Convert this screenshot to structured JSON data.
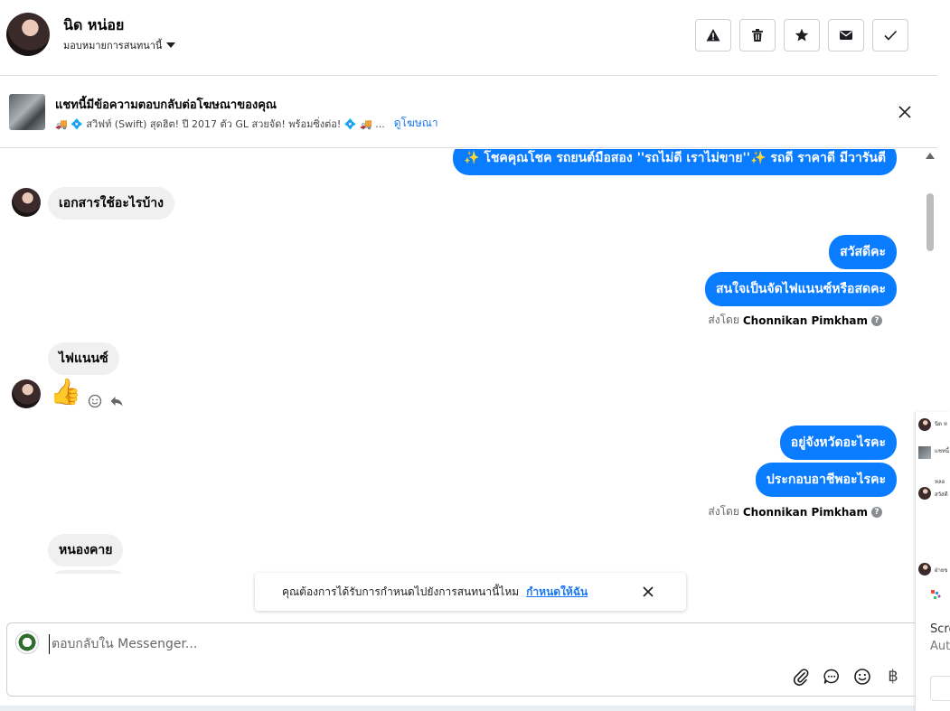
{
  "header": {
    "contact_name": "นิด หน่อย",
    "assign_label": "มอบหมายการสนทนานี้",
    "actions": [
      {
        "name": "spam-button",
        "icon": "warning-icon"
      },
      {
        "name": "delete-button",
        "icon": "trash-icon"
      },
      {
        "name": "star-button",
        "icon": "star-icon"
      },
      {
        "name": "mark-unread-button",
        "icon": "envelope-icon"
      },
      {
        "name": "done-button",
        "icon": "check-icon"
      }
    ]
  },
  "ad_banner": {
    "title": "แชทนี้มีข้อความตอบกลับต่อโฆษณาของคุณ",
    "description": "🚚 💠 สวิฟท์ (Swift) สุดฮิต! ปี 2017 ตัว GL สวยจัด! พร้อมซิ่งต่อ! 💠 🚚 ...",
    "link_label": "ดูโฆษณา"
  },
  "messages": {
    "top_partial": "✨ โชคคุณโชค รถยนต์มือสอง ''รถไม่ดี เราไม่ขาย''✨ รถดี ราคาดี มีวารันตี",
    "in_1": "เอกสารใช้อะไรบ้าง",
    "out_1": "สวัสดีคะ",
    "out_2": "สนใจเป็นจัดไฟแนนซ์หรือสดคะ",
    "sent_by_prefix_1": "ส่งโดย",
    "sent_by_name_1": "Chonnikan Pimkham",
    "in_2": "ไฟแนนซ์",
    "in_3_emoji": "👍",
    "out_3": "อยู่จังหวัดอะไรคะ",
    "out_4": "ประกอบอาชีพอะไรคะ",
    "sent_by_prefix_2": "ส่งโดย",
    "sent_by_name_2": "Chonnikan Pimkham",
    "in_4": "หนองคาย"
  },
  "toast": {
    "text": "คุณต้องการได้รับการกำหนดไปยังการสนทนานี้ไหม",
    "link_label": "กำหนดให้ฉัน"
  },
  "composer": {
    "placeholder": "ตอบกลับใน Messenger...",
    "tools": [
      "attachment-icon",
      "saved-reply-icon",
      "emoji-icon",
      "baht-icon",
      "thumbs-up-icon"
    ],
    "baht_symbol": "฿"
  },
  "side_panel": {
    "line1": "นิด ห",
    "line2": "แชทนี้",
    "line3": "หลอ",
    "line4": "สวัสดี",
    "line5": "ฝ่ายข",
    "title": "Scre",
    "subtitle": "Auto"
  },
  "colors": {
    "outgoing_bubble": "#0a7cff",
    "incoming_bubble": "#f0f0f0",
    "link": "#1877f2"
  }
}
